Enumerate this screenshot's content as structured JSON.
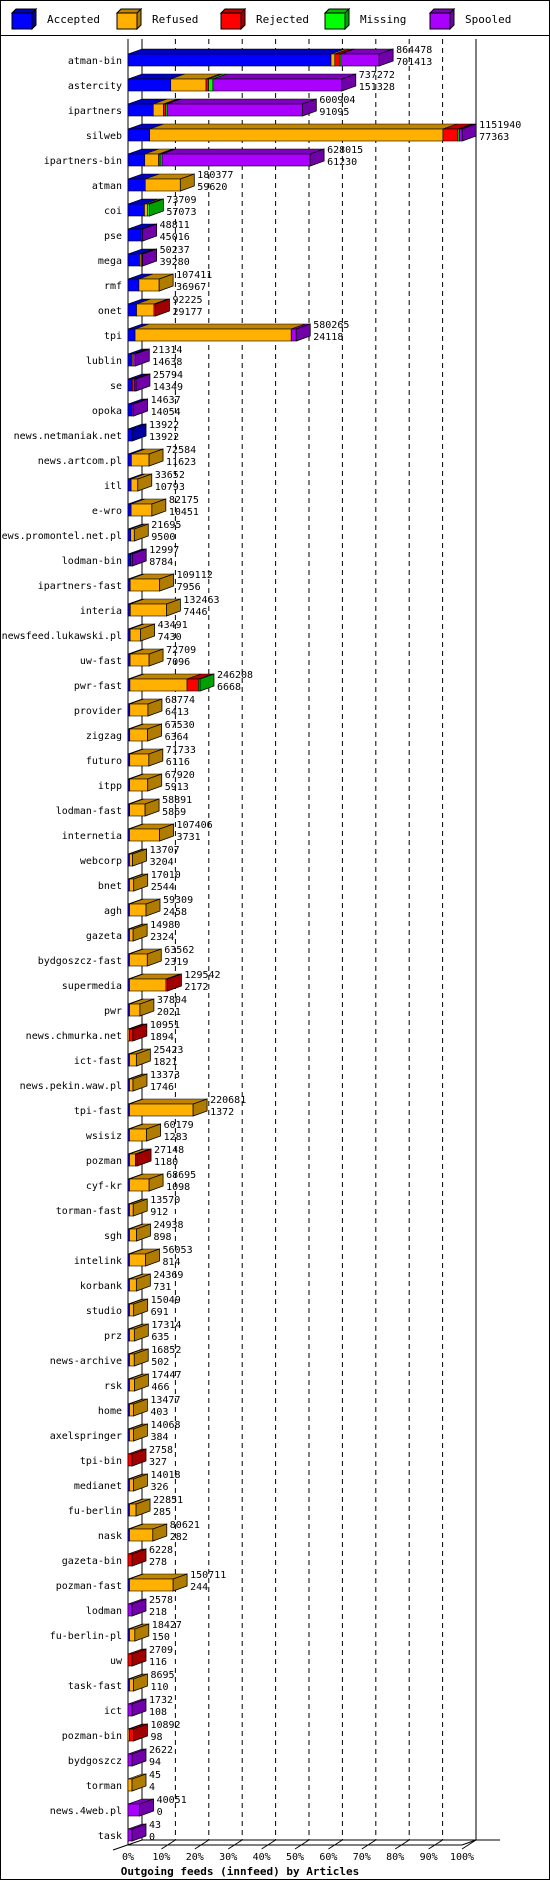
{
  "legend": [
    {
      "name": "Accepted",
      "color": "#0000ff",
      "side": "#0000a0"
    },
    {
      "name": "Refused",
      "color": "#ffb000",
      "side": "#b07c00"
    },
    {
      "name": "Rejected",
      "color": "#ff0000",
      "side": "#a00000"
    },
    {
      "name": "Missing",
      "color": "#00ff00",
      "side": "#00a000"
    },
    {
      "name": "Spooled",
      "color": "#aa00ff",
      "side": "#7000a8"
    }
  ],
  "chart_data": {
    "type": "bar",
    "orientation": "horizontal-stacked-3d",
    "title": "Outgoing feeds (innfeed) by Articles",
    "xlabel": "Outgoing feeds (innfeed) by Articles",
    "ylabel": "",
    "xlim": [
      0,
      100
    ],
    "x_unit": "% of max offered",
    "x_ticks": [
      "0%",
      "10%",
      "20%",
      "30%",
      "40%",
      "50%",
      "60%",
      "70%",
      "80%",
      "90%",
      "100%"
    ],
    "grid": true,
    "legend_position": "top",
    "series_names": [
      "Accepted",
      "Refused",
      "Rejected",
      "Missing",
      "Spooled"
    ],
    "categories": [
      {
        "name": "atman-bin",
        "total": "864478",
        "second": "701413",
        "shares": [
          0.81,
          0.015,
          0.018,
          0.004,
          0.153
        ]
      },
      {
        "name": "astercity",
        "total": "737272",
        "second": "151328",
        "shares": [
          0.2,
          0.165,
          0.012,
          0.02,
          0.603
        ]
      },
      {
        "name": "ipartners",
        "total": "600904",
        "second": "91095",
        "shares": [
          0.145,
          0.058,
          0.013,
          0.008,
          0.776
        ]
      },
      {
        "name": "silweb",
        "total": "1151940",
        "second": "77363",
        "shares": [
          0.065,
          0.878,
          0.045,
          0.004,
          0.008
        ]
      },
      {
        "name": "ipartners-bin",
        "total": "628015",
        "second": "61230",
        "shares": [
          0.092,
          0.076,
          0.009,
          0.01,
          0.813
        ]
      },
      {
        "name": "atman",
        "total": "180377",
        "second": "59620",
        "shares": [
          0.33,
          0.67,
          0,
          0,
          0
        ]
      },
      {
        "name": "coi",
        "total": "73709",
        "second": "57073",
        "shares": [
          0.77,
          0.14,
          0,
          0.09,
          0
        ]
      },
      {
        "name": "pse",
        "total": "48811",
        "second": "45016",
        "shares": [
          0.93,
          0,
          0,
          0,
          0.07
        ]
      },
      {
        "name": "mega",
        "total": "50237",
        "second": "39280",
        "shares": [
          0.79,
          0.1,
          0,
          0,
          0.11
        ]
      },
      {
        "name": "rmf",
        "total": "107411",
        "second": "36967",
        "shares": [
          0.35,
          0.65,
          0,
          0,
          0
        ]
      },
      {
        "name": "onet",
        "total": "92225",
        "second": "29177",
        "shares": [
          0.32,
          0.65,
          0.03,
          0,
          0
        ]
      },
      {
        "name": "tpi",
        "total": "580265",
        "second": "24118",
        "shares": [
          0.042,
          0.928,
          0,
          0,
          0.03
        ]
      },
      {
        "name": "lublin",
        "total": "21314",
        "second": "14638",
        "shares": [
          0.69,
          0.06,
          0,
          0,
          0.25
        ]
      },
      {
        "name": "se",
        "total": "25794",
        "second": "14349",
        "shares": [
          0.56,
          0,
          0.3,
          0,
          0.14
        ]
      },
      {
        "name": "opoka",
        "total": "14637",
        "second": "14054",
        "shares": [
          0.96,
          0,
          0,
          0,
          0.04
        ]
      },
      {
        "name": "news.netmaniak.net",
        "total": "13922",
        "second": "13922",
        "shares": [
          1,
          0,
          0,
          0,
          0
        ]
      },
      {
        "name": "news.artcom.pl",
        "total": "72584",
        "second": "11623",
        "shares": [
          0.16,
          0.84,
          0,
          0,
          0
        ]
      },
      {
        "name": "itl",
        "total": "33652",
        "second": "10793",
        "shares": [
          0.32,
          0.68,
          0,
          0,
          0
        ]
      },
      {
        "name": "e-wro",
        "total": "82175",
        "second": "10451",
        "shares": [
          0.13,
          0.87,
          0,
          0,
          0
        ]
      },
      {
        "name": "news.promontel.net.pl",
        "total": "21695",
        "second": "9500",
        "shares": [
          0.44,
          0.56,
          0,
          0,
          0
        ]
      },
      {
        "name": "lodman-bin",
        "total": "12997",
        "second": "8784",
        "shares": [
          0.68,
          0,
          0,
          0,
          0.32
        ]
      },
      {
        "name": "ipartners-fast",
        "total": "109112",
        "second": "7956",
        "shares": [
          0.07,
          0.93,
          0,
          0,
          0
        ]
      },
      {
        "name": "interia",
        "total": "132463",
        "second": "7446",
        "shares": [
          0.06,
          0.94,
          0,
          0,
          0
        ]
      },
      {
        "name": "newsfeed.lukawski.pl",
        "total": "43491",
        "second": "7430",
        "shares": [
          0.17,
          0.83,
          0,
          0,
          0
        ]
      },
      {
        "name": "uw-fast",
        "total": "72709",
        "second": "7096",
        "shares": [
          0.1,
          0.9,
          0,
          0,
          0
        ]
      },
      {
        "name": "pwr-fast",
        "total": "246208",
        "second": "6668",
        "shares": [
          0.027,
          0.8,
          0.16,
          0.013,
          0
        ]
      },
      {
        "name": "provider",
        "total": "68774",
        "second": "6413",
        "shares": [
          0.09,
          0.91,
          0,
          0,
          0
        ]
      },
      {
        "name": "zigzag",
        "total": "67530",
        "second": "6364",
        "shares": [
          0.09,
          0.91,
          0,
          0,
          0
        ]
      },
      {
        "name": "futuro",
        "total": "71733",
        "second": "6116",
        "shares": [
          0.085,
          0.915,
          0,
          0,
          0
        ]
      },
      {
        "name": "itpp",
        "total": "67920",
        "second": "5913",
        "shares": [
          0.087,
          0.913,
          0,
          0,
          0
        ]
      },
      {
        "name": "lodman-fast",
        "total": "58891",
        "second": "5869",
        "shares": [
          0.1,
          0.9,
          0,
          0,
          0
        ]
      },
      {
        "name": "internetia",
        "total": "107406",
        "second": "3731",
        "shares": [
          0.035,
          0.965,
          0,
          0,
          0
        ]
      },
      {
        "name": "webcorp",
        "total": "13707",
        "second": "3204",
        "shares": [
          0.23,
          0.77,
          0,
          0,
          0
        ]
      },
      {
        "name": "bnet",
        "total": "17010",
        "second": "2544",
        "shares": [
          0.15,
          0.85,
          0,
          0,
          0
        ]
      },
      {
        "name": "agh",
        "total": "59309",
        "second": "2458",
        "shares": [
          0.04,
          0.96,
          0,
          0,
          0
        ]
      },
      {
        "name": "gazeta",
        "total": "14980",
        "second": "2324",
        "shares": [
          0.16,
          0.84,
          0,
          0,
          0
        ]
      },
      {
        "name": "bydgoszcz-fast",
        "total": "63562",
        "second": "2319",
        "shares": [
          0.036,
          0.964,
          0,
          0,
          0
        ]
      },
      {
        "name": "supermedia",
        "total": "129542",
        "second": "2172",
        "shares": [
          0.017,
          0.97,
          0.013,
          0,
          0
        ]
      },
      {
        "name": "pwr",
        "total": "37804",
        "second": "2021",
        "shares": [
          0.053,
          0.947,
          0,
          0,
          0
        ]
      },
      {
        "name": "news.chmurka.net",
        "total": "10951",
        "second": "1894",
        "shares": [
          0,
          0.17,
          0.83,
          0,
          0
        ]
      },
      {
        "name": "ict-fast",
        "total": "25423",
        "second": "1821",
        "shares": [
          0.07,
          0.93,
          0,
          0,
          0
        ]
      },
      {
        "name": "news.pekin.waw.pl",
        "total": "13373",
        "second": "1746",
        "shares": [
          0.13,
          0.87,
          0,
          0,
          0
        ]
      },
      {
        "name": "tpi-fast",
        "total": "220681",
        "second": "1372",
        "shares": [
          0.006,
          0.994,
          0,
          0,
          0
        ]
      },
      {
        "name": "wsisiz",
        "total": "60179",
        "second": "1283",
        "shares": [
          0.02,
          0.98,
          0,
          0,
          0
        ]
      },
      {
        "name": "pozman",
        "total": "27148",
        "second": "1180",
        "shares": [
          0.04,
          0.75,
          0.21,
          0,
          0
        ]
      },
      {
        "name": "cyf-kr",
        "total": "68695",
        "second": "1098",
        "shares": [
          0.016,
          0.984,
          0,
          0,
          0
        ]
      },
      {
        "name": "torman-fast",
        "total": "13570",
        "second": "912",
        "shares": [
          0.067,
          0.933,
          0,
          0,
          0
        ]
      },
      {
        "name": "sgh",
        "total": "24938",
        "second": "898",
        "shares": [
          0.036,
          0.964,
          0,
          0,
          0
        ]
      },
      {
        "name": "intelink",
        "total": "56053",
        "second": "814",
        "shares": [
          0.015,
          0.985,
          0,
          0,
          0
        ]
      },
      {
        "name": "korbank",
        "total": "24369",
        "second": "731",
        "shares": [
          0.03,
          0.97,
          0,
          0,
          0
        ]
      },
      {
        "name": "studio",
        "total": "15049",
        "second": "691",
        "shares": [
          0.046,
          0.954,
          0,
          0,
          0
        ]
      },
      {
        "name": "prz",
        "total": "17314",
        "second": "635",
        "shares": [
          0.037,
          0.963,
          0,
          0,
          0
        ]
      },
      {
        "name": "news-archive",
        "total": "16852",
        "second": "502",
        "shares": [
          0.03,
          0.97,
          0,
          0,
          0
        ]
      },
      {
        "name": "rsk",
        "total": "17447",
        "second": "466",
        "shares": [
          0.027,
          0.973,
          0,
          0,
          0
        ]
      },
      {
        "name": "home",
        "total": "13477",
        "second": "403",
        "shares": [
          0.03,
          0.97,
          0,
          0,
          0
        ]
      },
      {
        "name": "axelspringer",
        "total": "14068",
        "second": "384",
        "shares": [
          0.027,
          0.973,
          0,
          0,
          0
        ]
      },
      {
        "name": "tpi-bin",
        "total": "2758",
        "second": "327",
        "shares": [
          0,
          0,
          1,
          0,
          0
        ]
      },
      {
        "name": "medianet",
        "total": "14018",
        "second": "326",
        "shares": [
          0.023,
          0.977,
          0,
          0,
          0
        ]
      },
      {
        "name": "fu-berlin",
        "total": "22851",
        "second": "285",
        "shares": [
          0.012,
          0.988,
          0,
          0,
          0
        ]
      },
      {
        "name": "nask",
        "total": "80621",
        "second": "282",
        "shares": [
          0.004,
          0.996,
          0,
          0,
          0
        ]
      },
      {
        "name": "gazeta-bin",
        "total": "6228",
        "second": "278",
        "shares": [
          0,
          0,
          1,
          0,
          0
        ]
      },
      {
        "name": "pozman-fast",
        "total": "150711",
        "second": "244",
        "shares": [
          0.002,
          0.998,
          0,
          0,
          0
        ]
      },
      {
        "name": "lodman",
        "total": "2578",
        "second": "218",
        "shares": [
          0,
          0,
          0,
          0,
          1
        ]
      },
      {
        "name": "fu-berlin-pl",
        "total": "18427",
        "second": "150",
        "shares": [
          0.008,
          0.992,
          0,
          0,
          0
        ]
      },
      {
        "name": "uw",
        "total": "2709",
        "second": "116",
        "shares": [
          0,
          0,
          1,
          0,
          0
        ]
      },
      {
        "name": "task-fast",
        "total": "8695",
        "second": "110",
        "shares": [
          0.013,
          0.987,
          0,
          0,
          0
        ]
      },
      {
        "name": "ict",
        "total": "1732",
        "second": "108",
        "shares": [
          0,
          0,
          0,
          0,
          1
        ]
      },
      {
        "name": "pozman-bin",
        "total": "10892",
        "second": "98",
        "shares": [
          0,
          0.009,
          0.991,
          0,
          0
        ]
      },
      {
        "name": "bydgoszcz",
        "total": "2622",
        "second": "94",
        "shares": [
          0,
          0,
          0,
          0,
          1
        ]
      },
      {
        "name": "torman",
        "total": "45",
        "second": "4",
        "shares": [
          0,
          1,
          0,
          0,
          0
        ]
      },
      {
        "name": "news.4web.pl",
        "total": "40051",
        "second": "0",
        "shares": [
          0,
          0,
          0,
          0,
          1
        ]
      },
      {
        "name": "task",
        "total": "43",
        "second": "0",
        "shares": [
          0,
          0,
          0,
          0,
          1
        ]
      }
    ],
    "bar_face_colors": [
      "#0000ff",
      "#ffb000",
      "#ff0000",
      "#00ff00",
      "#aa00ff"
    ],
    "bar_top_colors": [
      "#0000c0",
      "#c08400",
      "#c00000",
      "#00c000",
      "#8000c0"
    ],
    "tail_rows_style": "hidden-front"
  }
}
